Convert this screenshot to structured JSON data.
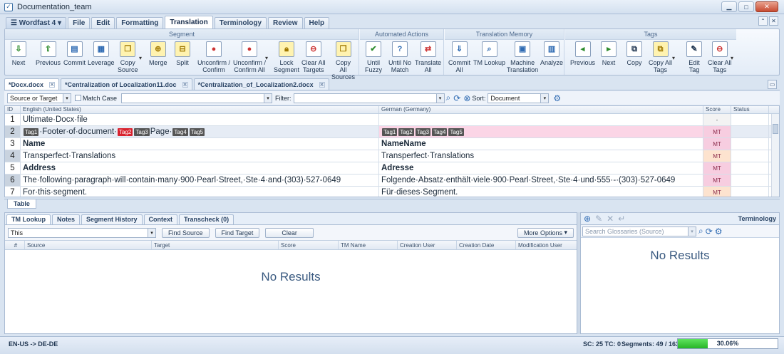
{
  "window": {
    "title": "Documentation_team"
  },
  "menu": {
    "app_button": "Wordfast 4",
    "tabs": [
      "File",
      "Edit",
      "Formatting",
      "Translation",
      "Terminology",
      "Review",
      "Help"
    ]
  },
  "ribbon": {
    "groups": [
      "Segment",
      "Automated Actions",
      "Translation Memory",
      "Tags"
    ],
    "segment": {
      "next": "Next",
      "previous": "Previous",
      "commit": "Commit",
      "leverage": "Leverage",
      "copy_source_1": "Copy",
      "copy_source_2": "Source",
      "merge": "Merge",
      "split": "Split",
      "unconfirm_1": "Unconfirm /",
      "unconfirm_2": "Confirm",
      "unconfirm_all_1": "Unconfirm /",
      "unconfirm_all_2": "Confirm All",
      "lock_1": "Lock",
      "lock_2": "Segment",
      "clear_all_1": "Clear All",
      "clear_all_2": "Targets",
      "copy_all_1": "Copy",
      "copy_all_2": "All Sources"
    },
    "automated": {
      "until_fuzzy_1": "Until",
      "until_fuzzy_2": "Fuzzy",
      "until_nomatch_1": "Until No",
      "until_nomatch_2": "Match",
      "translate_all_1": "Translate",
      "translate_all_2": "All"
    },
    "tm": {
      "commit_all_1": "Commit",
      "commit_all_2": "All",
      "tm_lookup": "TM Lookup",
      "machine_1": "Machine",
      "machine_2": "Translation",
      "analyze": "Analyze"
    },
    "tags": {
      "previous": "Previous",
      "next": "Next",
      "copy": "Copy",
      "copy_all_1": "Copy All",
      "copy_all_2": "Tags",
      "edit_1": "Edit",
      "edit_2": "Tag",
      "clear_all_1": "Clear All",
      "clear_all_2": "Tags"
    }
  },
  "doc_tabs": [
    "*Docx.docx",
    "*Centralization of Localization11.doc",
    "*Centralization_of_Localization2.docx"
  ],
  "filter_bar": {
    "scope": "Source or Target",
    "match_case": "Match Case",
    "filter_label": "Filter:",
    "sort_label": "Sort:",
    "sort_value": "Document"
  },
  "grid": {
    "headers": {
      "id": "ID",
      "source": "English (United States)",
      "target": "German (Germany)",
      "score": "Score",
      "status": "Status"
    },
    "rows": [
      {
        "id": "1",
        "source": "Ultimate·Docx·file",
        "target": "",
        "score": "-"
      },
      {
        "id": "2",
        "source_pre": "·Footer·of·document·",
        "source_mid": "Page·",
        "target": "",
        "score": "MT"
      },
      {
        "id": "3",
        "source": "Name",
        "target": "NameName",
        "score": "MT"
      },
      {
        "id": "4",
        "source": "Transperfect·Translations",
        "target": "Transperfect·Translations",
        "score": "MT"
      },
      {
        "id": "5",
        "source": "Address",
        "target": "Adresse",
        "score": "MT"
      },
      {
        "id": "6",
        "source": "The·following·paragraph·will·contain·many·900·Pearl·Street,·Ste·4·and·(303)·527-0649",
        "target": "Folgende·Absatz·enthält·viele·900·Pearl·Street,·Ste·4·und·555·-·(303)·527-0649",
        "score": "MT"
      },
      {
        "id": "7",
        "source": "For·this·segment.",
        "target": "Für·dieses·Segment.",
        "score": "MT"
      }
    ],
    "tags": [
      "Tag1",
      "Tag2",
      "Tag3",
      "Tag4",
      "Tag5"
    ],
    "table_tab": "Table"
  },
  "tm_panel": {
    "tabs": [
      "TM Lookup",
      "Notes",
      "Segment History",
      "Context",
      "Transcheck (0)"
    ],
    "query": "This",
    "find_source": "Find Source",
    "find_target": "Find Target",
    "clear": "Clear",
    "more_options": "More Options",
    "columns": [
      "#",
      "Source",
      "Target",
      "Score",
      "TM Name",
      "Creation User",
      "Creation Date",
      "Modification User"
    ],
    "no_results": "No Results"
  },
  "term_panel": {
    "title": "Terminology",
    "search_placeholder": "Search Glossaries (Source)",
    "no_results": "No Results"
  },
  "status": {
    "lang": "EN-US -> DE-DE",
    "sc_tc": "SC: 25 TC: 0",
    "segments": "Segments: 49 / 163",
    "progress_pct": "30.06%",
    "progress_fraction": 0.3006
  }
}
